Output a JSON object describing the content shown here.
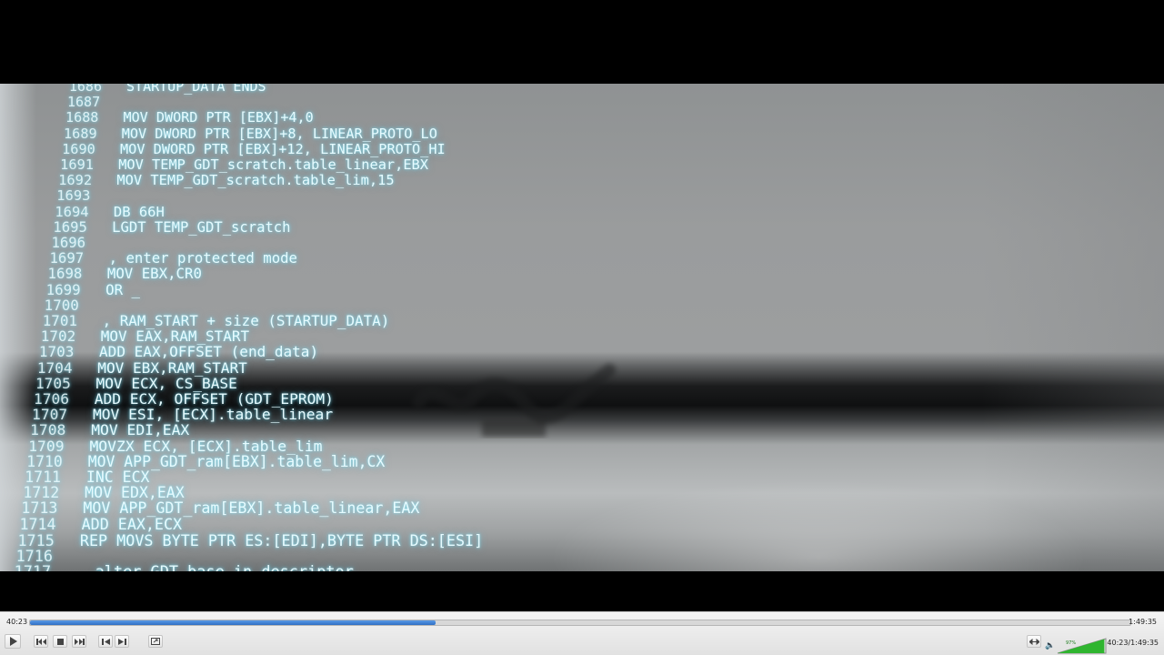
{
  "player": {
    "elapsed": "40:23",
    "duration": "1:49:35",
    "progress": 0.369,
    "time_display": "40:23/1:49:35",
    "volume": "97%",
    "accent_color": "#2f6fc4"
  },
  "code_lines": [
    {
      "n": "1686",
      "t": " STARTUP_DATA ENDS"
    },
    {
      "n": "1687",
      "t": ""
    },
    {
      "n": "1688",
      "t": " MOV DWORD PTR [EBX]+4,0"
    },
    {
      "n": "1689",
      "t": " MOV DWORD PTR [EBX]+8, LINEAR_PROTO_LO"
    },
    {
      "n": "1690",
      "t": " MOV DWORD PTR [EBX]+12, LINEAR_PROTO_HI"
    },
    {
      "n": "1691",
      "t": " MOV TEMP_GDT_scratch.table_linear,EBX"
    },
    {
      "n": "1692",
      "t": " MOV TEMP_GDT_scratch.table_lim,15"
    },
    {
      "n": "1693",
      "t": ""
    },
    {
      "n": "1694",
      "t": " DB 66H"
    },
    {
      "n": "1695",
      "t": " LGDT TEMP_GDT_scratch"
    },
    {
      "n": "1696",
      "t": ""
    },
    {
      "n": "1697",
      "t": " , enter protected mode"
    },
    {
      "n": "1698",
      "t": " MOV EBX,CR0"
    },
    {
      "n": "1699",
      "t": " OR _"
    },
    {
      "n": "1700",
      "t": ""
    },
    {
      "n": "1701",
      "t": " , RAM_START + size (STARTUP_DATA)"
    },
    {
      "n": "1702",
      "t": " MOV EAX,RAM_START"
    },
    {
      "n": "1703",
      "t": " ADD EAX,OFFSET (end_data)"
    },
    {
      "n": "1704",
      "t": " MOV EBX,RAM_START"
    },
    {
      "n": "1705",
      "t": " MOV ECX, CS_BASE"
    },
    {
      "n": "1706",
      "t": " ADD ECX, OFFSET (GDT_EPROM)"
    },
    {
      "n": "1707",
      "t": " MOV ESI, [ECX].table_linear"
    },
    {
      "n": "1708",
      "t": " MOV EDI,EAX"
    },
    {
      "n": "1709",
      "t": " MOVZX ECX, [ECX].table_lim"
    },
    {
      "n": "1710",
      "t": " MOV APP_GDT_ram[EBX].table_lim,CX"
    },
    {
      "n": "1711",
      "t": " INC ECX"
    },
    {
      "n": "1712",
      "t": " MOV EDX,EAX"
    },
    {
      "n": "1713",
      "t": " MOV APP_GDT_ram[EBX].table_linear,EAX"
    },
    {
      "n": "1714",
      "t": " ADD EAX,ECX"
    },
    {
      "n": "1715",
      "t": " REP MOVS BYTE PTR ES:[EDI],BYTE PTR DS:[ESI]"
    },
    {
      "n": "1716",
      "t": ""
    },
    {
      "n": "1717",
      "t": "   alter GDT base in descriptor"
    }
  ],
  "icons": {
    "play": "play-icon",
    "prev": "skip-back-icon",
    "stop": "stop-icon",
    "next": "skip-forward-icon",
    "frame_back": "frame-back-icon",
    "frame_forward": "frame-forward-icon",
    "fullscreen": "fullscreen-icon",
    "aspect": "aspect-ratio-icon",
    "speaker": "speaker-icon"
  }
}
